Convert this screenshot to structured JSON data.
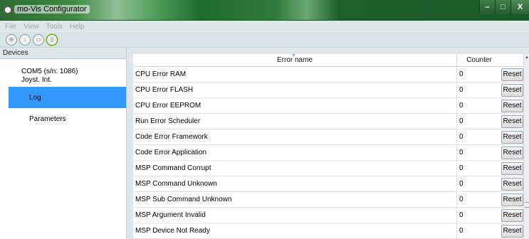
{
  "window": {
    "title": "mo-Vis Configurator",
    "minimize": "–",
    "maximize": "□",
    "close": "X"
  },
  "menu": [
    "File",
    "View",
    "Tools",
    "Help"
  ],
  "toolbar": [
    {
      "icon": "connect-icon",
      "glyph": "⊕"
    },
    {
      "icon": "download-icon",
      "glyph": "↓"
    },
    {
      "icon": "save-icon",
      "glyph": "▭"
    },
    {
      "icon": "document-icon",
      "glyph": "▯"
    }
  ],
  "devices": {
    "header": "Devices",
    "device_name": "COM5 (s/n: 1086)",
    "device_type": "Joyst. Int.",
    "items": [
      "Log",
      "Parameters"
    ]
  },
  "table": {
    "col_name": "Error name",
    "col_counter": "Counter",
    "reset_label": "Reset",
    "rows": [
      {
        "name": "CPU Error RAM",
        "count": "0"
      },
      {
        "name": "CPU Error FLASH",
        "count": "0"
      },
      {
        "name": "CPU Error EEPROM",
        "count": "0"
      },
      {
        "name": "Run Error Scheduler",
        "count": "0"
      },
      {
        "name": "Code Error Framework",
        "count": "0"
      },
      {
        "name": "Code Error Application",
        "count": "0"
      },
      {
        "name": "MSP Command Corrupt",
        "count": "0"
      },
      {
        "name": "MSP Command Unknown",
        "count": "0"
      },
      {
        "name": "MSP Sub Command Unknown",
        "count": "0"
      },
      {
        "name": "MSP Argument Invalid",
        "count": "0"
      },
      {
        "name": "MSP Device Not Ready",
        "count": "0"
      }
    ]
  },
  "colors": {
    "selected": "#3399ff",
    "titlebar": "#2f7a3b"
  }
}
